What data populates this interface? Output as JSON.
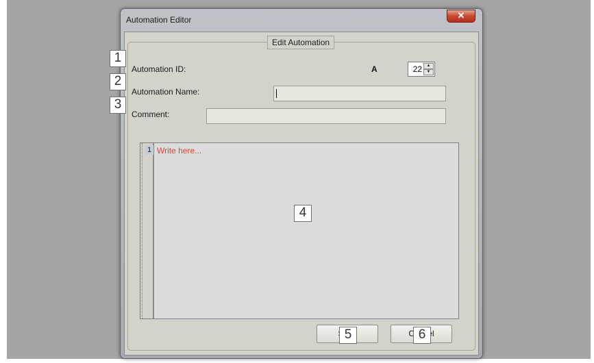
{
  "window": {
    "title": "Automation Editor",
    "close_glyph": "✕"
  },
  "group": {
    "legend": "Edit Automation"
  },
  "fields": {
    "automation_id_label": "Automation ID:",
    "automation_id_prefix": "A",
    "automation_id_value": "22",
    "automation_name_label": "Automation Name:",
    "automation_name_value": "",
    "comment_label": "Comment:",
    "comment_value": ""
  },
  "editor": {
    "line_numbers": [
      "1"
    ],
    "placeholder": "Write here...",
    "placeholder_color": "#e8432e"
  },
  "buttons": {
    "save": "Save",
    "cancel": "Cancel"
  },
  "callouts": [
    "1",
    "2",
    "3",
    "4",
    "5",
    "6"
  ],
  "icons": {
    "spin_up": "up-arrow",
    "spin_down": "down-arrow",
    "close": "close-x"
  }
}
